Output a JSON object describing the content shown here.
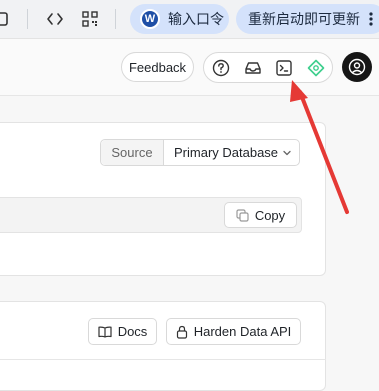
{
  "browser_toolbar": {
    "command_pill_label": "输入口令",
    "command_pill_logo": "W",
    "restart_pill_label": "重新启动即可更新",
    "accent_color": "#d4e2fb"
  },
  "header": {
    "feedback_label": "Feedback",
    "tool_icons": [
      "help-icon",
      "inbox-icon",
      "terminal-icon",
      "ai-assistant-icon"
    ]
  },
  "source_selector": {
    "label": "Source",
    "value": "Primary Database"
  },
  "code_block": {
    "copy_label": "Copy"
  },
  "api_section": {
    "docs_label": "Docs",
    "harden_label": "Harden Data API"
  },
  "annotation": {
    "arrow_color": "#e53935",
    "points_to": "terminal-icon"
  }
}
